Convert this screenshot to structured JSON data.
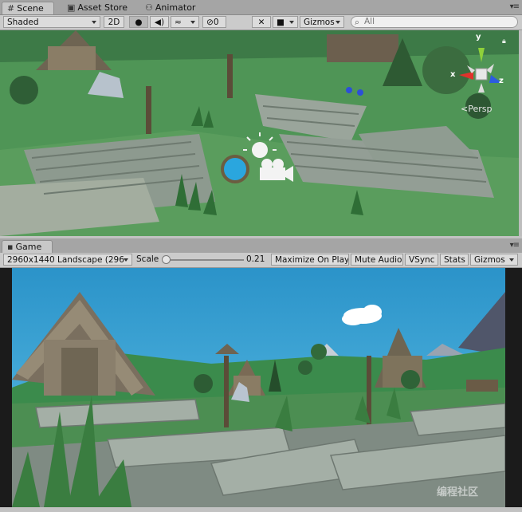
{
  "scene_tabs": {
    "scene": "Scene",
    "asset_store": "Asset Store",
    "animator": "Animator"
  },
  "scene_toolbar": {
    "shading_mode": "Shaded",
    "mode_2d": "2D",
    "hidden_count": "0",
    "gizmos": "Gizmos",
    "search_placeholder": "All"
  },
  "gizmo": {
    "axis_y": "y",
    "axis_x": "x",
    "axis_z": "z",
    "projection": "Persp"
  },
  "game_tab": {
    "label": "Game"
  },
  "game_toolbar": {
    "resolution": "2960x1440 Landscape (296",
    "scale_label": "Scale",
    "scale_value": "0.21",
    "maximize_on_play": "Maximize On Play",
    "mute_audio": "Mute Audio",
    "vsync": "VSync",
    "stats": "Stats",
    "gizmos": "Gizmos"
  },
  "watermark": "编程社区",
  "colors": {
    "editor_bg": "#c2c2c2",
    "tab_bar": "#a5a5a5",
    "sky": "#2f9fd0",
    "grass": "#3f8a4d",
    "letterbox": "#1b1b1b",
    "axis_x": "#e0322c",
    "axis_y": "#8fd13a",
    "axis_z": "#2c5ce0"
  },
  "icons": [
    "grid-icon",
    "store-icon",
    "animator-icon",
    "light-icon",
    "audio-icon",
    "effects-icon",
    "eye-icon",
    "tools-icon",
    "camera-icon",
    "lock-icon",
    "menu-icon",
    "game-icon",
    "search-icon"
  ]
}
